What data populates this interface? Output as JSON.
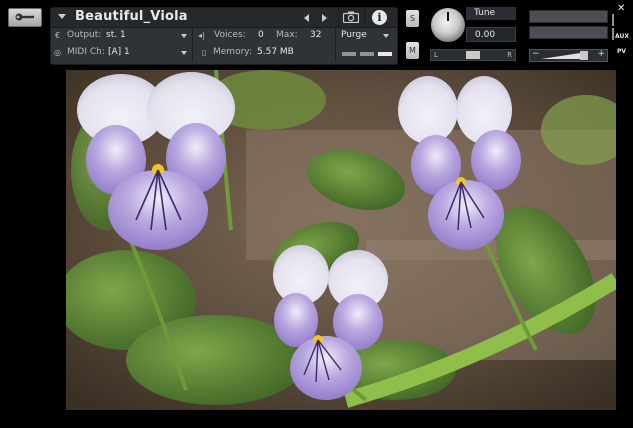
{
  "instrument": {
    "name": "Beautiful_Viola",
    "output_label": "Output:",
    "output_value": "st. 1",
    "voices_label": "Voices:",
    "voices_value": "0",
    "max_label": "Max:",
    "max_value": "32",
    "purge_label": "Purge",
    "midi_label": "MIDI Ch:",
    "midi_value": "[A]  1",
    "memory_label": "Memory:",
    "memory_value": "5.57 MB",
    "info_icon": "i"
  },
  "buttons": {
    "solo": "S",
    "mute": "M",
    "close": "✕"
  },
  "tune": {
    "label": "Tune",
    "value": "0.00"
  },
  "pan": {
    "left": "L",
    "right": "R"
  },
  "volume": {
    "minus": "−",
    "plus": "+"
  },
  "side_labels": {
    "aux": "AUX",
    "pv": "PV"
  },
  "icons": {
    "tool": "wrench-icon",
    "snapshot": "camera-icon",
    "info": "info-icon",
    "output": "output-icon",
    "midi": "midi-icon",
    "memory": "memory-icon",
    "voices": "voices-icon"
  },
  "colors": {
    "panel": "#2f3337",
    "panel_dark": "#25292c",
    "text": "#e6e9eb",
    "background": "#000000"
  }
}
